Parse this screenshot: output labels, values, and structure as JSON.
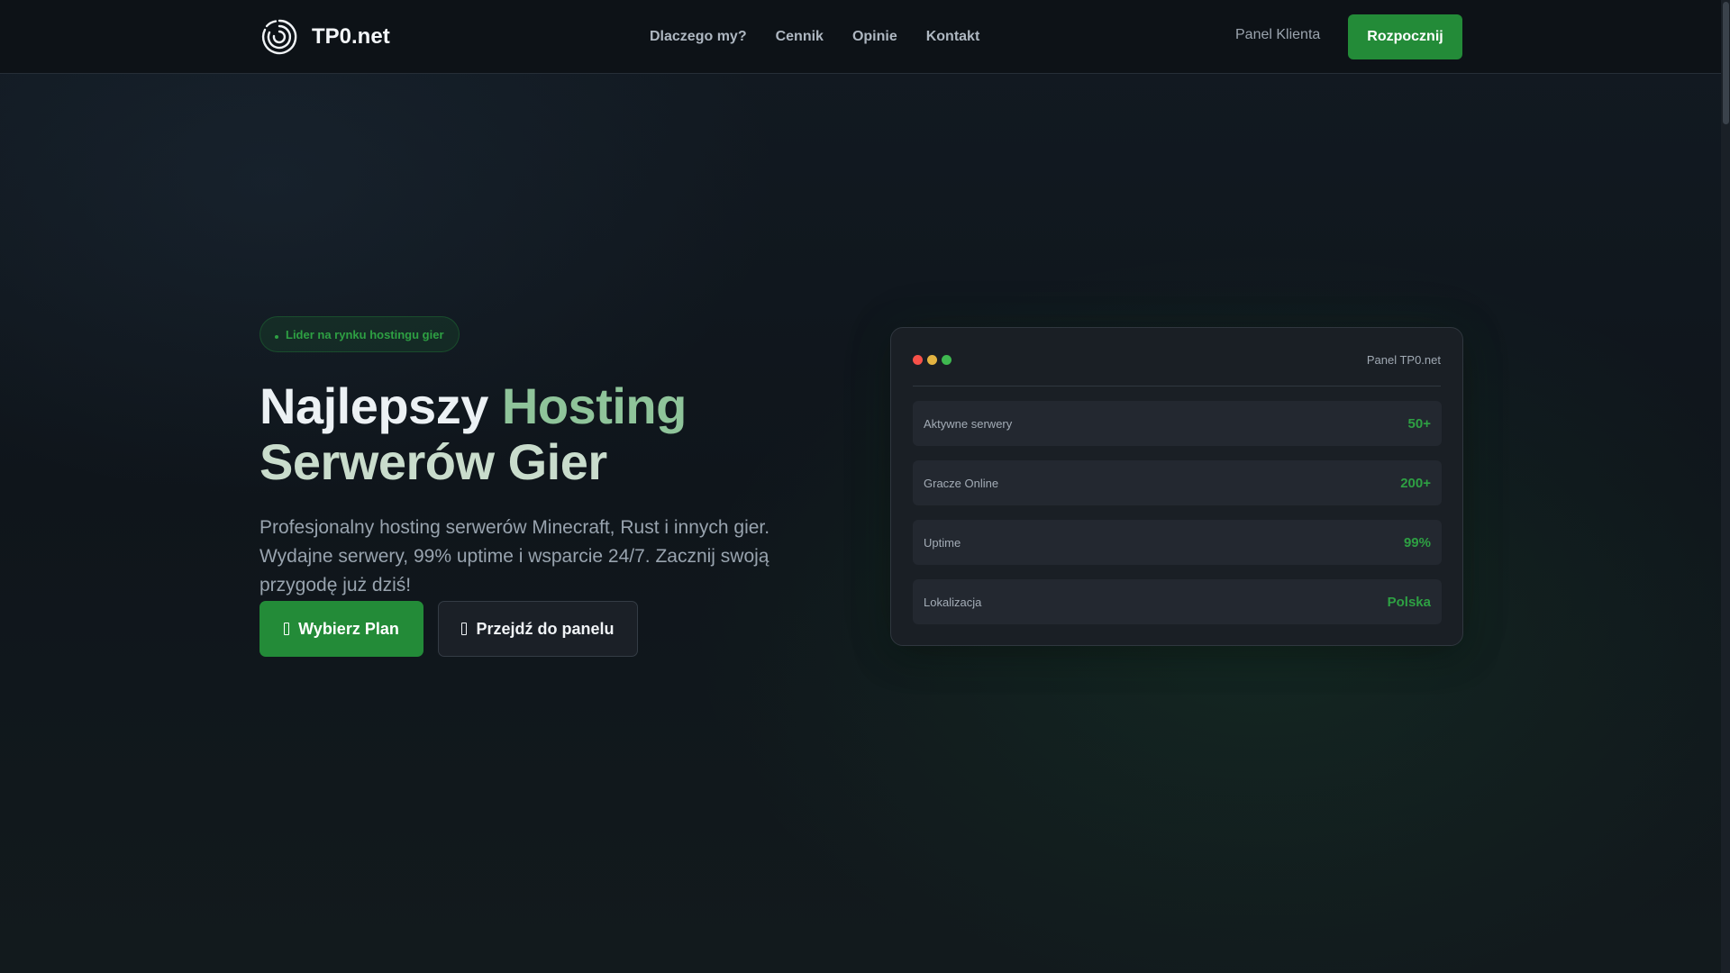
{
  "header": {
    "brand": "TP0.net",
    "nav": [
      "Dlaczego my?",
      "Cennik",
      "Opinie",
      "Kontakt"
    ],
    "panel_link": "Panel Klienta",
    "cta": "Rozpocznij"
  },
  "hero": {
    "badge": "Lider na rynku hostingu gier",
    "title_part1": "Najlepszy ",
    "title_part2": "Hosting",
    "title_part3": "Serwerów Gier",
    "description": "Profesjonalny hosting serwerów Minecraft, Rust i innych gier. Wydajne serwery, 99% uptime i wsparcie 24/7. Zacznij swoją przygodę już dziś!",
    "btn_primary": "Wybierz Plan",
    "btn_secondary": "Przejdź do panelu"
  },
  "panel": {
    "title": "Panel TP0.net",
    "rows": [
      {
        "label": "Aktywne serwery",
        "value": "50+"
      },
      {
        "label": "Gracze Online",
        "value": "200+"
      },
      {
        "label": "Uptime",
        "value": "99%"
      },
      {
        "label": "Lokalizacja",
        "value": "Polska"
      }
    ]
  },
  "colors": {
    "accent": "#238b38",
    "accent_text": "#2ea043",
    "dot_red": "#f85149",
    "dot_yellow": "#e3b341",
    "dot_green": "#3fb950"
  },
  "icons": {
    "logo": "spiral-logo-icon",
    "badge": "dot-icon",
    "primary_button": "server-icon",
    "secondary_button": "panel-icon"
  }
}
